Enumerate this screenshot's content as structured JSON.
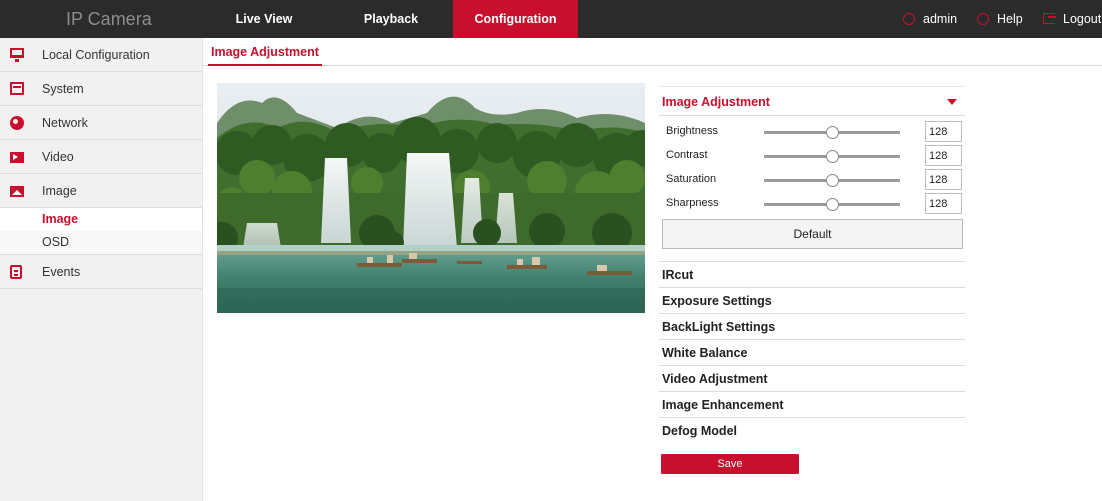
{
  "header": {
    "brand": "IP Camera",
    "tabs": [
      {
        "label": "Live View"
      },
      {
        "label": "Playback"
      },
      {
        "label": "Configuration"
      }
    ],
    "user": "admin",
    "help": "Help",
    "logout": "Logout"
  },
  "sidebar": {
    "items": [
      {
        "label": "Local Configuration"
      },
      {
        "label": "System"
      },
      {
        "label": "Network"
      },
      {
        "label": "Video"
      },
      {
        "label": "Image"
      },
      {
        "label": "Events"
      }
    ],
    "subitems": [
      {
        "label": "Image"
      },
      {
        "label": "OSD"
      }
    ]
  },
  "page": {
    "tab": "Image Adjustment"
  },
  "panel": {
    "title": "Image Adjustment",
    "sliders": [
      {
        "label": "Brightness",
        "value": "128",
        "level": 0.5
      },
      {
        "label": "Contrast",
        "value": "128",
        "level": 0.5
      },
      {
        "label": "Saturation",
        "value": "128",
        "level": 0.5
      },
      {
        "label": "Sharpness",
        "value": "128",
        "level": 0.5
      }
    ],
    "default_label": "Default",
    "sections": [
      {
        "label": "IRcut"
      },
      {
        "label": "Exposure Settings"
      },
      {
        "label": "BackLight Settings"
      },
      {
        "label": "White Balance"
      },
      {
        "label": "Video Adjustment"
      },
      {
        "label": "Image Enhancement"
      },
      {
        "label": "Defog Model"
      }
    ],
    "save_label": "Save"
  },
  "colors": {
    "accent": "#c8102e",
    "topbar": "#2b2b2b",
    "sidebar": "#f1f1f1"
  }
}
